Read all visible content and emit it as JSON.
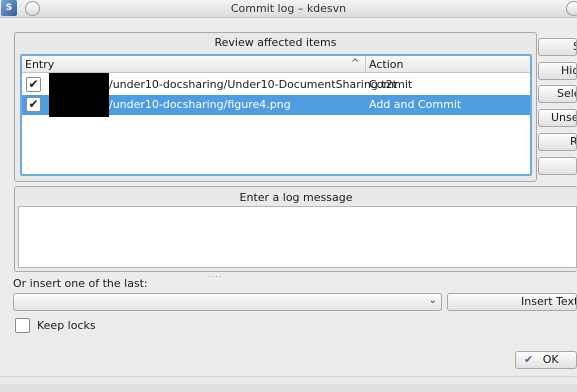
{
  "window": {
    "title": "Commit log – kdesvn",
    "app_icon_glyph": "S"
  },
  "affected": {
    "title": "Review affected items",
    "columns": {
      "entry": "Entry",
      "action": "Action"
    },
    "rows": [
      {
        "checked_glyph": "✔",
        "path": "/under10-docsharing/Under10-DocumentSharing.t2t",
        "action": "Commit"
      },
      {
        "checked_glyph": "✔",
        "path": "/under10-docsharing/figure4.png",
        "action": "Add and Commit"
      }
    ]
  },
  "side_buttons": [
    "S",
    "Hid",
    "Sele",
    "Unsel",
    "R",
    ""
  ],
  "log": {
    "title": "Enter a log message",
    "value": ""
  },
  "history": {
    "label": "Or insert one of the last:",
    "selected": "",
    "arrow_glyph": "⌄"
  },
  "insert_button": "Insert Textfi",
  "keep_locks": {
    "label": "Keep locks",
    "checked": false
  },
  "ok": {
    "label": "OK",
    "check_glyph": "✔"
  },
  "splitter_glyph": "....",
  "sort_glyph": "^",
  "colors": {
    "selection": "#4d9de0",
    "focus_border": "#6eaedf"
  }
}
